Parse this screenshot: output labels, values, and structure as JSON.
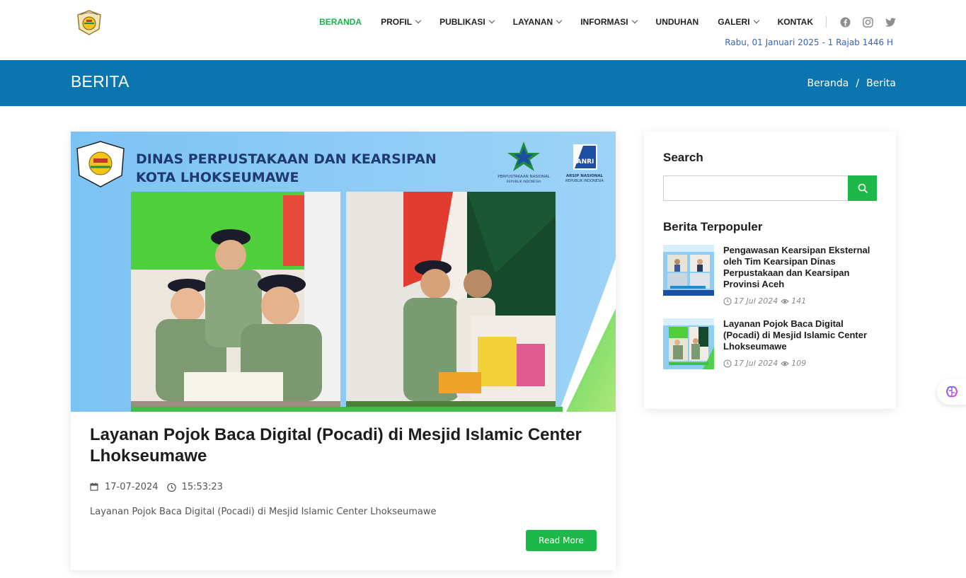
{
  "header": {
    "nav": [
      {
        "label": "BERANDA",
        "active": true,
        "dropdown": false
      },
      {
        "label": "PROFIL",
        "active": false,
        "dropdown": true
      },
      {
        "label": "PUBLIKASI",
        "active": false,
        "dropdown": true
      },
      {
        "label": "LAYANAN",
        "active": false,
        "dropdown": true
      },
      {
        "label": "INFORMASI",
        "active": false,
        "dropdown": true
      },
      {
        "label": "UNDUHAN",
        "active": false,
        "dropdown": false
      },
      {
        "label": "GALERI",
        "active": false,
        "dropdown": true
      },
      {
        "label": "KONTAK",
        "active": false,
        "dropdown": false
      }
    ],
    "social": [
      "facebook-icon",
      "instagram-icon",
      "twitter-icon"
    ],
    "date": "Rabu, 01 Januari 2025 - 1 Rajab 1446 H"
  },
  "page": {
    "title": "BERITA",
    "breadcrumb": [
      "Beranda",
      "Berita"
    ]
  },
  "article": {
    "hero": {
      "heading_line1": "DINAS PERPUSTAKAAN DAN KEARSIPAN",
      "heading_line2": "KOTA LHOKSEUMAWE",
      "logo_left_text": "PERPUSTAKAAN NASIONAL",
      "logo_left_sub": "REPUBLIK INDONESIA",
      "logo_right_text": "ARSIP NASIONAL",
      "logo_right_sub": "REPUBLIK INDONESIA",
      "logo_right_mark": "ANRI"
    },
    "title": "Layanan Pojok Baca Digital (Pocadi) di Mesjid Islamic Center Lhokseumawe",
    "date": "17-07-2024",
    "time": "15:53:23",
    "excerpt": "Layanan Pojok Baca Digital (Pocadi) di Mesjid Islamic Center Lhokseumawe",
    "read_more": "Read More"
  },
  "sidebar": {
    "search_title": "Search",
    "search_placeholder": "",
    "popular_title": "Berita Terpopuler",
    "popular": [
      {
        "title": "Pengawasan Kearsipan Eksternal oleh Tim Kearsipan Dinas Perpustakaan dan Kearsipan Provinsi Aceh",
        "date": "17 Jul 2024",
        "views": "141"
      },
      {
        "title": "Layanan Pojok Baca Digital (Pocadi) di Mesjid Islamic Center Lhokseumawe",
        "date": "17 Jul 2024",
        "views": "109"
      }
    ]
  },
  "colors": {
    "accent_green": "#1eb84a",
    "title_bar_blue": "#0b75b0",
    "date_blue": "#3a63b8"
  }
}
